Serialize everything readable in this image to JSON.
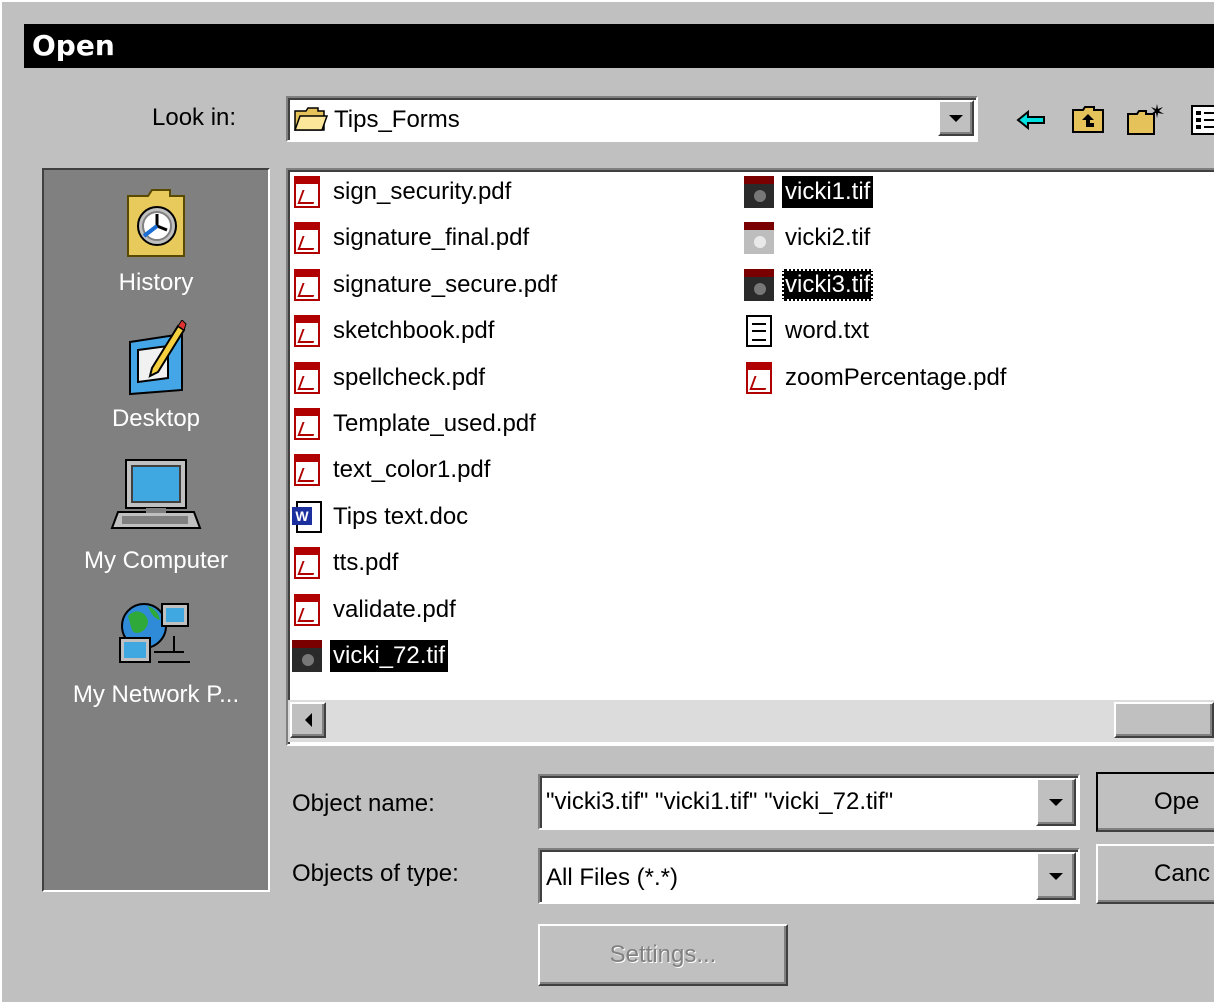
{
  "window": {
    "title": "Open"
  },
  "look_in": {
    "label": "Look in:",
    "value": "Tips_Forms"
  },
  "toolbar": {
    "icons": [
      "back-arrow-icon",
      "up-folder-icon",
      "new-folder-icon",
      "view-menu-icon"
    ]
  },
  "places": [
    {
      "label": "History",
      "icon": "history-icon"
    },
    {
      "label": "Desktop",
      "icon": "desktop-icon"
    },
    {
      "label": "My Computer",
      "icon": "my-computer-icon"
    },
    {
      "label": "My Network P...",
      "icon": "network-places-icon"
    }
  ],
  "files": {
    "col1": [
      {
        "name": "sign_security.pdf",
        "type": "pdf",
        "selected": false
      },
      {
        "name": "signature_final.pdf",
        "type": "pdf",
        "selected": false
      },
      {
        "name": "signature_secure.pdf",
        "type": "pdf",
        "selected": false
      },
      {
        "name": "sketchbook.pdf",
        "type": "pdf",
        "selected": false
      },
      {
        "name": "spellcheck.pdf",
        "type": "pdf",
        "selected": false
      },
      {
        "name": "Template_used.pdf",
        "type": "pdf",
        "selected": false
      },
      {
        "name": "text_color1.pdf",
        "type": "pdf",
        "selected": false
      },
      {
        "name": "Tips text.doc",
        "type": "doc",
        "selected": false
      },
      {
        "name": "tts.pdf",
        "type": "pdf",
        "selected": false
      },
      {
        "name": "validate.pdf",
        "type": "pdf",
        "selected": false
      },
      {
        "name": "vicki_72.tif",
        "type": "tif",
        "selected": true
      }
    ],
    "col2": [
      {
        "name": "vicki1.tif",
        "type": "tif",
        "selected": true
      },
      {
        "name": "vicki2.tif",
        "type": "tif-light",
        "selected": false
      },
      {
        "name": "vicki3.tif",
        "type": "tif",
        "selected": true,
        "focused": true
      },
      {
        "name": "word.txt",
        "type": "txt",
        "selected": false
      },
      {
        "name": "zoomPercentage.pdf",
        "type": "pdf",
        "selected": false
      }
    ]
  },
  "object_name": {
    "label": "Object name:",
    "value": "\"vicki3.tif\" \"vicki1.tif\" \"vicki_72.tif\""
  },
  "object_type": {
    "label": "Objects of type:",
    "value": "All Files (*.*)"
  },
  "buttons": {
    "open": "Ope",
    "cancel": "Canc",
    "settings": "Settings..."
  }
}
